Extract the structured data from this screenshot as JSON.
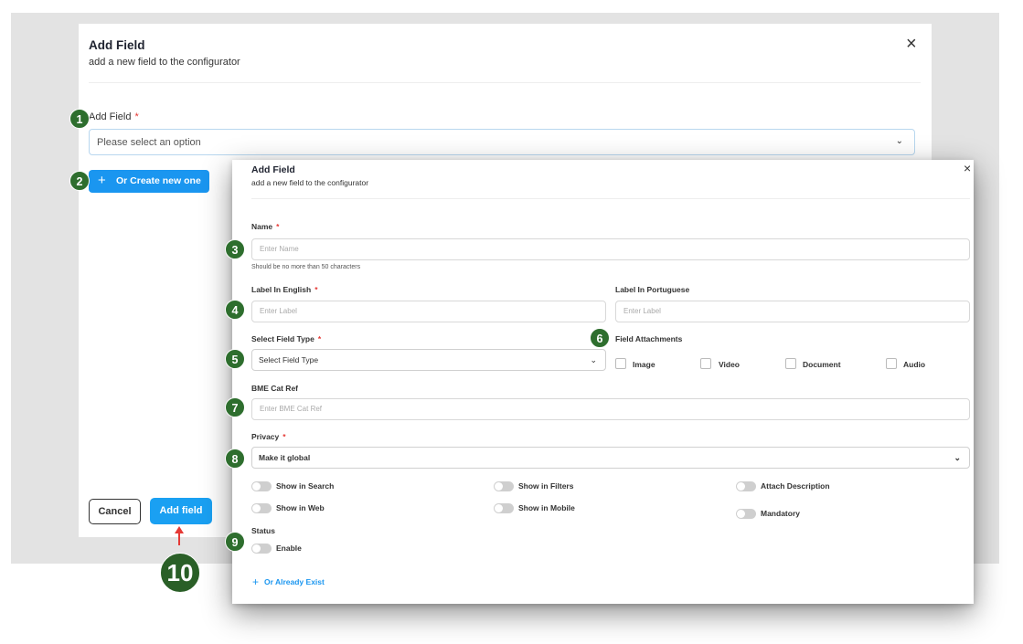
{
  "dialog_main": {
    "title": "Add Field",
    "subtitle": "add a new field to the configurator",
    "close_icon": "×",
    "field_label": "Add Field",
    "required_mark": "*",
    "select_placeholder": "Please select an option",
    "chevron": "⌄",
    "create_new_plus": "+",
    "create_new_label": "Or Create new one",
    "cancel_label": "Cancel",
    "add_label": "Add field"
  },
  "dialog_create": {
    "title": "Add Field",
    "subtitle": "add a new field to the configurator",
    "close_icon": "×",
    "name_label": "Name",
    "name_placeholder": "Enter Name",
    "name_hint": "Should be no more than 50 characters",
    "label_en": "Label In English",
    "label_en_placeholder": "Enter Label",
    "label_pt": "Label In Portuguese",
    "label_pt_placeholder": "Enter Label",
    "field_type_label": "Select Field Type",
    "field_type_value": "Select Field Type",
    "attachments_label": "Field Attachments",
    "attachments": [
      "Image",
      "Video",
      "Document",
      "Audio"
    ],
    "bme_label": "BME Cat Ref",
    "bme_placeholder": "Enter BME Cat Ref",
    "privacy_label": "Privacy",
    "privacy_value": "Make it global",
    "toggles": [
      "Show in Search",
      "Show in Filters",
      "Attach Description",
      "Show in Web",
      "Show in Mobile",
      "Mandatory"
    ],
    "status_label": "Status",
    "status_toggle": "Enable",
    "already_exist_plus": "+",
    "already_exist_label": "Or Already Exist",
    "chevron": "⌄",
    "required_mark": "*"
  },
  "markers": [
    "1",
    "2",
    "3",
    "4",
    "5",
    "6",
    "7",
    "8",
    "9",
    "10"
  ],
  "colors": {
    "accent": "#1a96f0",
    "marker": "#2e6e2e",
    "required": "#e53935",
    "arrow": "#e53935"
  }
}
